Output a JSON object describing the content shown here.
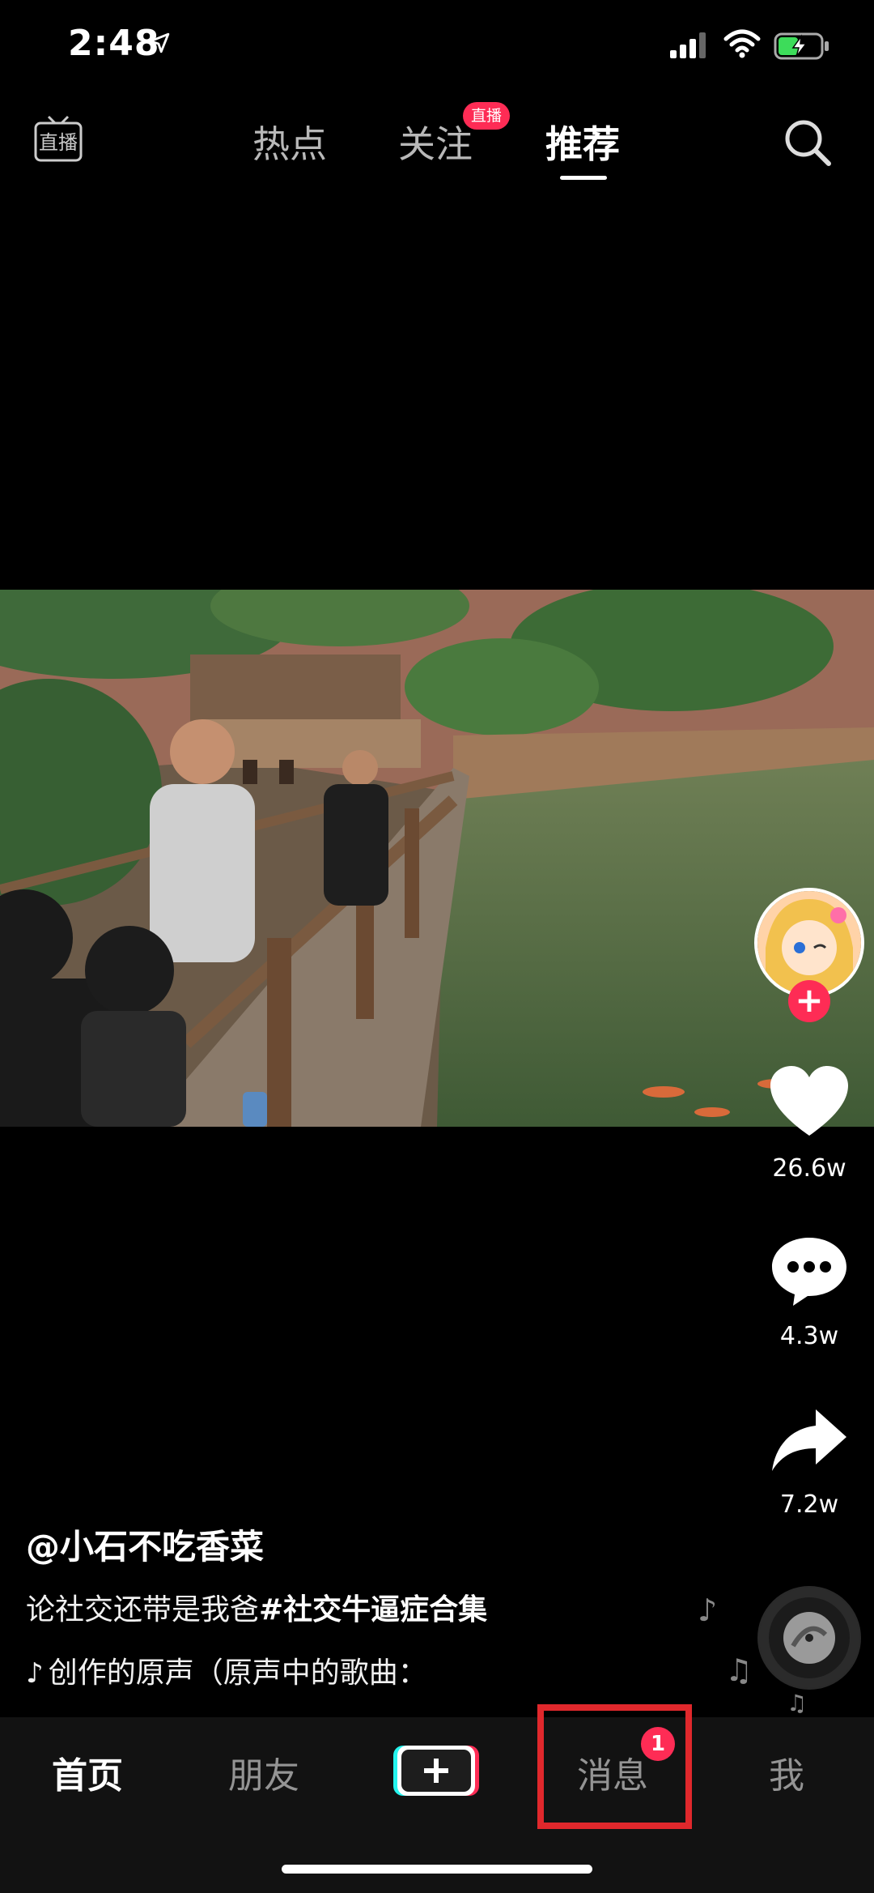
{
  "status_bar": {
    "time": "2:48"
  },
  "top_nav": {
    "live_label": "直播",
    "tabs": [
      {
        "label": "热点"
      },
      {
        "label": "关注"
      },
      {
        "label": "推荐"
      }
    ],
    "follow_badge": "直播",
    "active_tab": "推荐"
  },
  "video": {
    "author": "@小石不吃香菜",
    "description": "论社交还带是我爸",
    "hashtag": "#社交牛逼症合集",
    "music": "创作的原声（原声中的歌曲："
  },
  "actions": {
    "likes": "26.6w",
    "comments": "4.3w",
    "shares": "7.2w"
  },
  "bottom_nav": {
    "home": "首页",
    "friends": "朋友",
    "messages": "消息",
    "messages_badge": "1",
    "me": "我"
  },
  "colors": {
    "accent": "#fe2c55",
    "highlight": "#e0282c",
    "tabbar_bg": "#121212"
  }
}
